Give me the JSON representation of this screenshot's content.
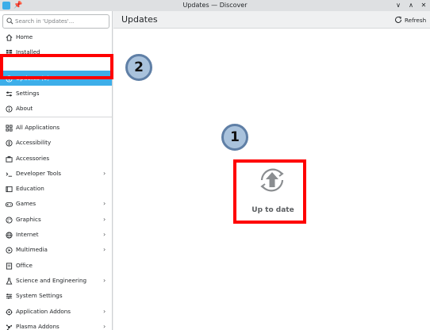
{
  "window": {
    "title": "Updates — Discover"
  },
  "sidebar": {
    "search_placeholder": "Search in 'Updates'...",
    "top_items": [
      {
        "label": "Home",
        "icon": "home-icon"
      },
      {
        "label": "Installed",
        "icon": "installed-icon"
      },
      {
        "label": "Updates (0)",
        "icon": "updates-icon",
        "selected": true
      },
      {
        "label": "Settings",
        "icon": "settings-icon"
      },
      {
        "label": "About",
        "icon": "about-icon"
      }
    ],
    "categories": [
      {
        "label": "All Applications",
        "icon": "grid-icon",
        "has_children": false
      },
      {
        "label": "Accessibility",
        "icon": "accessibility-icon",
        "has_children": false
      },
      {
        "label": "Accessories",
        "icon": "briefcase-icon",
        "has_children": false
      },
      {
        "label": "Developer Tools",
        "icon": "code-icon",
        "has_children": true
      },
      {
        "label": "Education",
        "icon": "book-icon",
        "has_children": false
      },
      {
        "label": "Games",
        "icon": "gamepad-icon",
        "has_children": true
      },
      {
        "label": "Graphics",
        "icon": "palette-icon",
        "has_children": true
      },
      {
        "label": "Internet",
        "icon": "globe-icon",
        "has_children": true
      },
      {
        "label": "Multimedia",
        "icon": "media-icon",
        "has_children": true
      },
      {
        "label": "Office",
        "icon": "document-icon",
        "has_children": false
      },
      {
        "label": "Science and Engineering",
        "icon": "flask-icon",
        "has_children": true
      },
      {
        "label": "System Settings",
        "icon": "sliders-icon",
        "has_children": false
      },
      {
        "label": "Application Addons",
        "icon": "puzzle-icon",
        "has_children": true
      },
      {
        "label": "Plasma Addons",
        "icon": "plasma-icon",
        "has_children": true
      }
    ]
  },
  "main": {
    "page_title": "Updates",
    "refresh_label": "Refresh",
    "status_text": "Up to date"
  },
  "annotations": {
    "badge_1": "1",
    "badge_2": "2"
  },
  "colors": {
    "accent": "#3daee9",
    "highlight_box": "#ff0000",
    "badge_fill": "#a9c2dc",
    "badge_border": "#5f7fa6"
  }
}
